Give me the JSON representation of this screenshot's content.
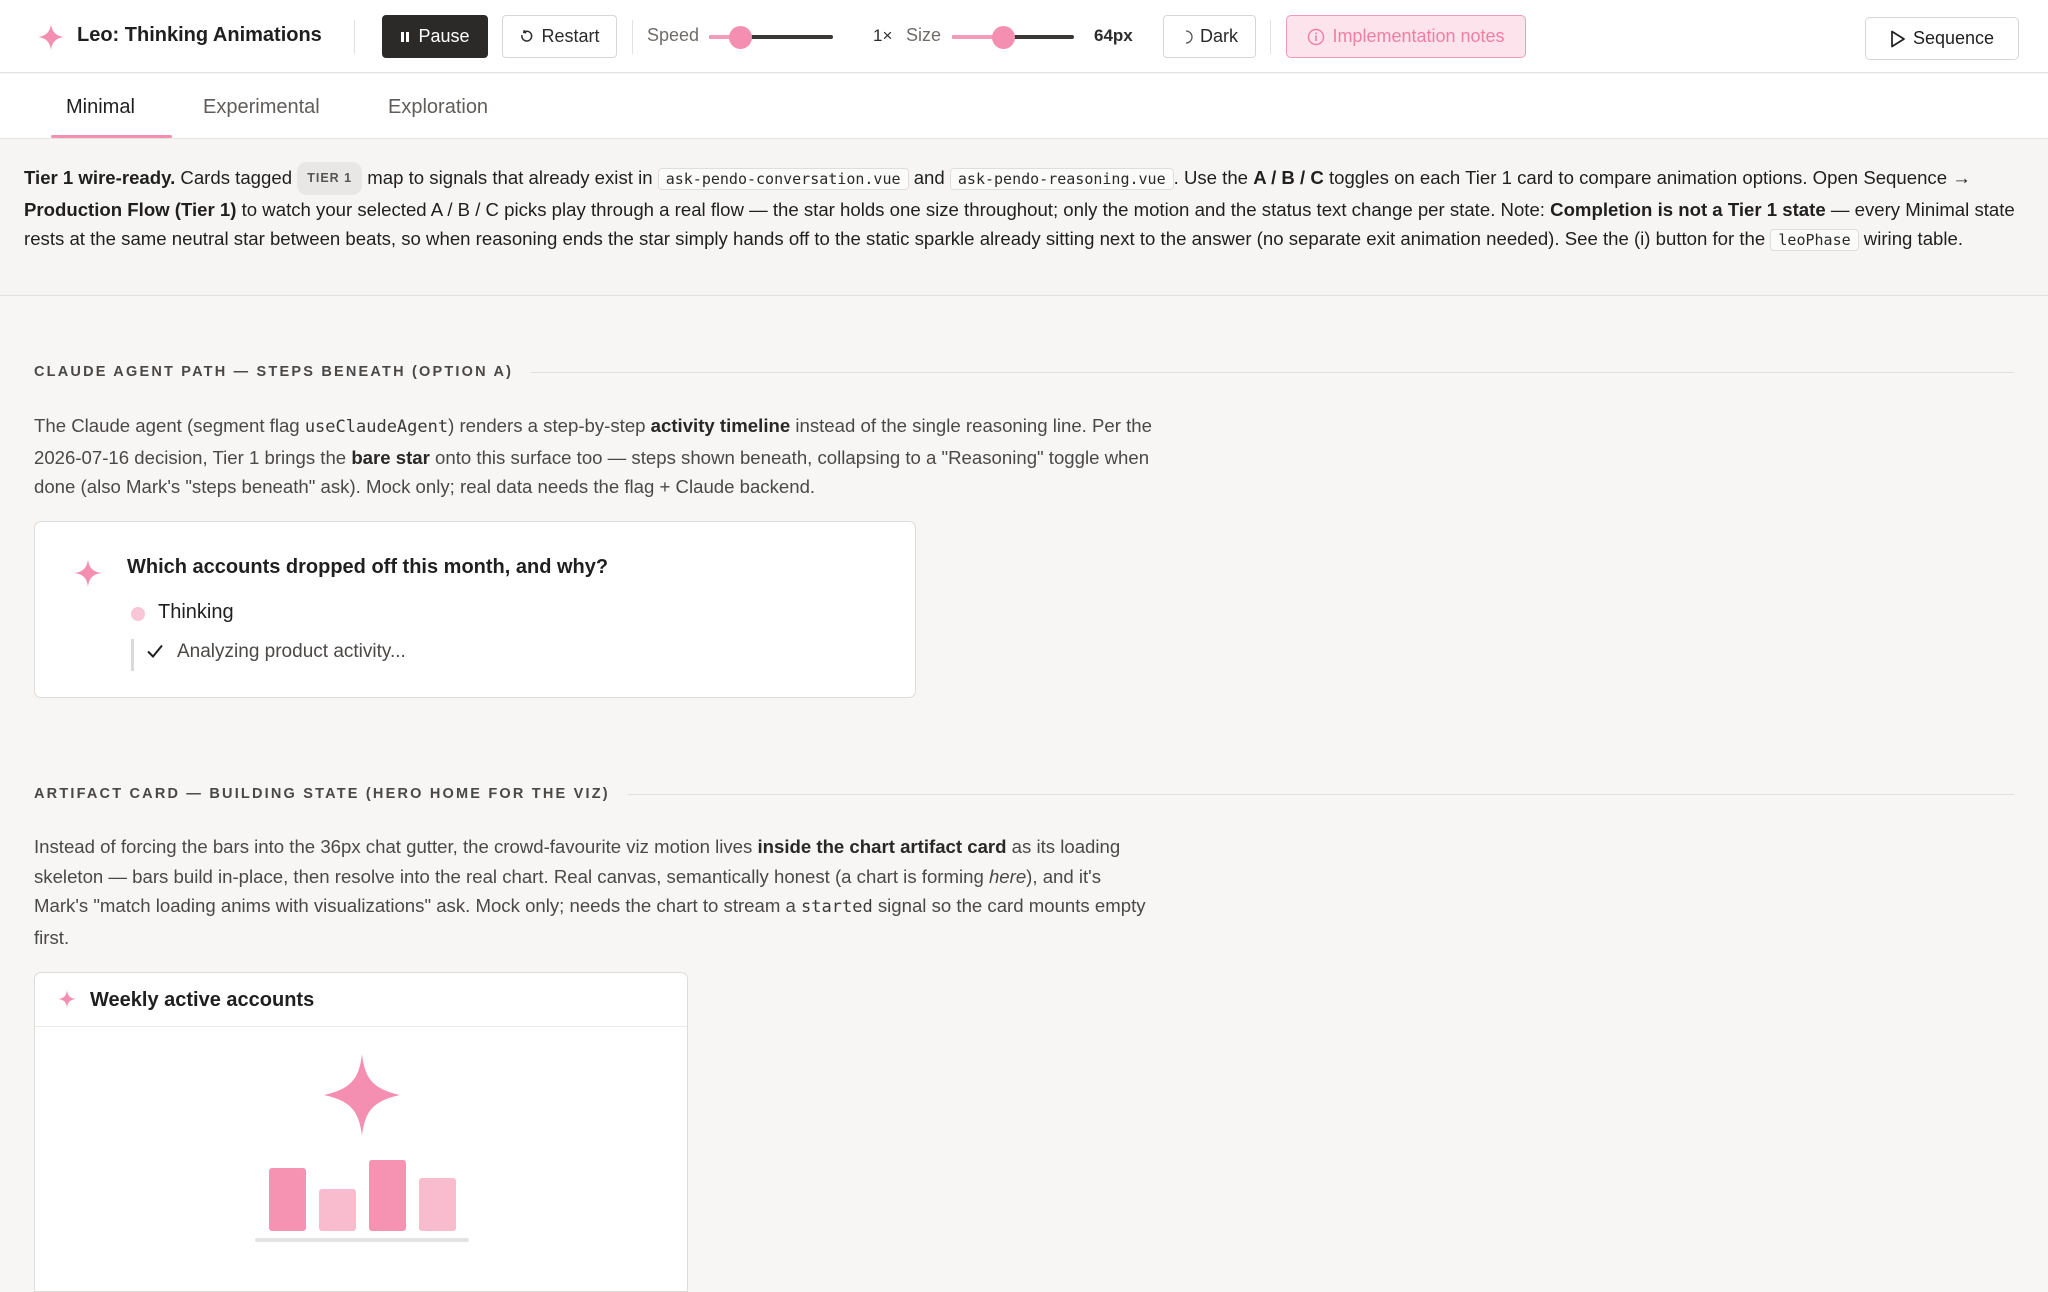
{
  "toolbar": {
    "app_title": "Leo: Thinking Animations",
    "pause_label": "Pause",
    "restart_label": "Restart",
    "speed_label": "Speed",
    "speed_value": "1×",
    "speed_level": 0.25,
    "size_label": "Size",
    "size_value": "64px",
    "size_level": 0.42,
    "dark_label": "Dark",
    "notes_label": "Implementation notes",
    "sequence_label": "Sequence",
    "accent_color": "#f48fb1"
  },
  "tabs": [
    {
      "label": "Minimal",
      "active": true
    },
    {
      "label": "Experimental",
      "active": false
    },
    {
      "label": "Exploration",
      "active": false
    }
  ],
  "notice": {
    "lead": "Tier 1 wire-ready.",
    "t1": " Cards tagged ",
    "badge": "TIER 1",
    "t2": " map to signals that already exist in ",
    "file1": "ask-pendo-conversation.vue",
    "t3": " and ",
    "file2": "ask-pendo-reasoning.vue",
    "t4": ". Use the ",
    "b1": "A / B / C",
    "t5": " toggles on each Tier 1 card to compare animation options. Open Sequence → ",
    "b2": "Production Flow (Tier 1)",
    "t6": " to watch your selected A / B / C picks play through a real flow — the star holds one size throughout; only the motion and the status text change per state. Note: ",
    "b3": "Completion is not a Tier 1 state",
    "t7": " — every Minimal state rests at the same neutral star between beats, so when reasoning ends the star simply hands off to the static sparkle already sitting next to the answer (no separate exit animation needed). See the (i) button for the ",
    "code1": "leoPhase",
    "t8": " wiring table."
  },
  "section1": {
    "heading": "CLAUDE AGENT PATH — STEPS BENEATH (OPTION A)",
    "p1": "The Claude agent (segment flag ",
    "code": "useClaudeAgent",
    "p2": ") renders a step-by-step ",
    "b1": "activity timeline",
    "p3": " instead of the single reasoning line. Per the 2026-07-16 decision, Tier 1 brings the ",
    "b2": "bare star",
    "p4": " onto this surface too — steps shown beneath, collapsing to a \"Reasoning\" toggle when done (also Mark's \"steps beneath\" ask). Mock only; real data needs the flag + Claude backend.",
    "card": {
      "question": "Which accounts dropped off this month, and why?",
      "status": "Thinking",
      "step": "Analyzing product activity..."
    }
  },
  "section2": {
    "heading": "ARTIFACT CARD — BUILDING STATE (HERO HOME FOR THE VIZ)",
    "p1": "Instead of forcing the bars into the 36px chat gutter, the crowd-favourite viz motion lives ",
    "b1": "inside the chart artifact card",
    "p2": " as its loading skeleton — bars build in-place, then resolve into the real chart. Real canvas, semantically honest (a chart is forming ",
    "i1": "here",
    "p3": "), and it's Mark's \"match loading anims with visualizations\" ask. Mock only; needs the chart to stream a ",
    "code": "started",
    "p4": " signal so the card mounts empty first.",
    "card": {
      "title": "Weekly active accounts",
      "skeleton_bar_levels": [
        0.6,
        0.4,
        0.68,
        0.5
      ],
      "bar_colors": [
        "#f692b2",
        "#f9bccf",
        "#f692b2",
        "#f9bccf"
      ]
    }
  }
}
